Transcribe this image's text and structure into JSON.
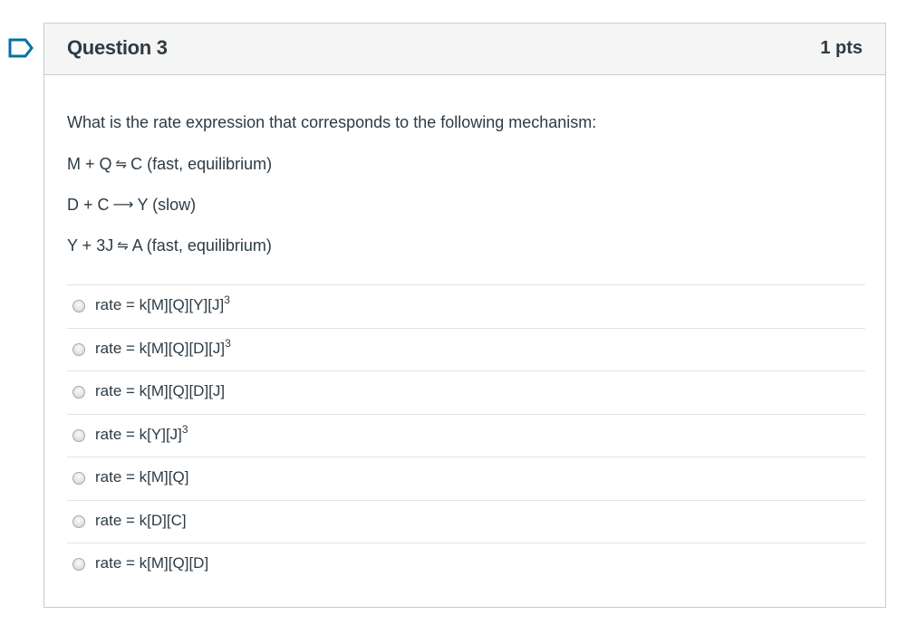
{
  "flag": {
    "icon": "bookmark-flag-icon",
    "color": "#0770a3"
  },
  "question": {
    "title": "Question 3",
    "points": "1 pts",
    "stem": "What is the rate expression that corresponds to the following mechanism:",
    "steps": [
      {
        "left": "M + Q",
        "arrow": "⇋",
        "right": "C (fast, equilibrium)"
      },
      {
        "left": "D + C",
        "arrow": "⟶",
        "right": "Y (slow)"
      },
      {
        "left": "Y + 3J",
        "arrow": "⇋",
        "right": "A (fast, equilibrium)"
      }
    ],
    "answers": [
      {
        "label": "rate = k[M][Q][Y][J]",
        "exponent": "3"
      },
      {
        "label": "rate = k[M][Q][D][J]",
        "exponent": "3"
      },
      {
        "label": "rate = k[M][Q][D][J]",
        "exponent": ""
      },
      {
        "label": "rate = k[Y][J]",
        "exponent": "3"
      },
      {
        "label": "rate = k[M][Q]",
        "exponent": ""
      },
      {
        "label": "rate = k[D][C]",
        "exponent": ""
      },
      {
        "label": "rate = k[M][Q][D]",
        "exponent": ""
      }
    ]
  }
}
